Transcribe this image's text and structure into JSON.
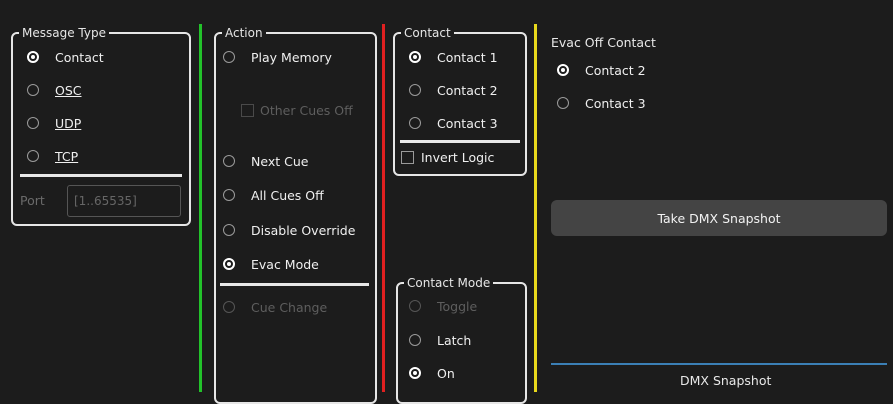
{
  "message_type": {
    "legend": "Message Type",
    "options": [
      {
        "label": "Contact",
        "checked": true
      },
      {
        "label": "OSC",
        "checked": false
      },
      {
        "label": "UDP",
        "checked": false
      },
      {
        "label": "TCP",
        "checked": false
      }
    ],
    "port_label": "Port",
    "port_placeholder": "[1..65535]"
  },
  "action": {
    "legend": "Action",
    "play_memory": "Play Memory",
    "other_cues_off": "Other Cues Off",
    "next_cue": "Next Cue",
    "all_cues_off": "All Cues Off",
    "disable_override": "Disable Override",
    "evac_mode": "Evac Mode",
    "cue_change": "Cue Change",
    "selected": "Evac Mode"
  },
  "contact": {
    "legend": "Contact",
    "options": [
      {
        "label": "Contact 1",
        "checked": true
      },
      {
        "label": "Contact 2",
        "checked": false
      },
      {
        "label": "Contact 3",
        "checked": false
      }
    ],
    "invert_logic": "Invert Logic"
  },
  "contact_mode": {
    "legend": "Contact Mode",
    "toggle": "Toggle",
    "latch": "Latch",
    "on": "On",
    "selected": "On"
  },
  "evac": {
    "title": "Evac Off Contact",
    "options": [
      {
        "label": "Contact 2",
        "checked": true
      },
      {
        "label": "Contact 3",
        "checked": false
      }
    ]
  },
  "take_snapshot_button": "Take DMX Snapshot",
  "dmx_snapshot_label": "DMX Snapshot",
  "colors": {
    "divider_green": "#22c22a",
    "divider_red": "#e02020",
    "divider_yellow": "#e8d81c",
    "snapshot_line": "#3b7fb5"
  }
}
